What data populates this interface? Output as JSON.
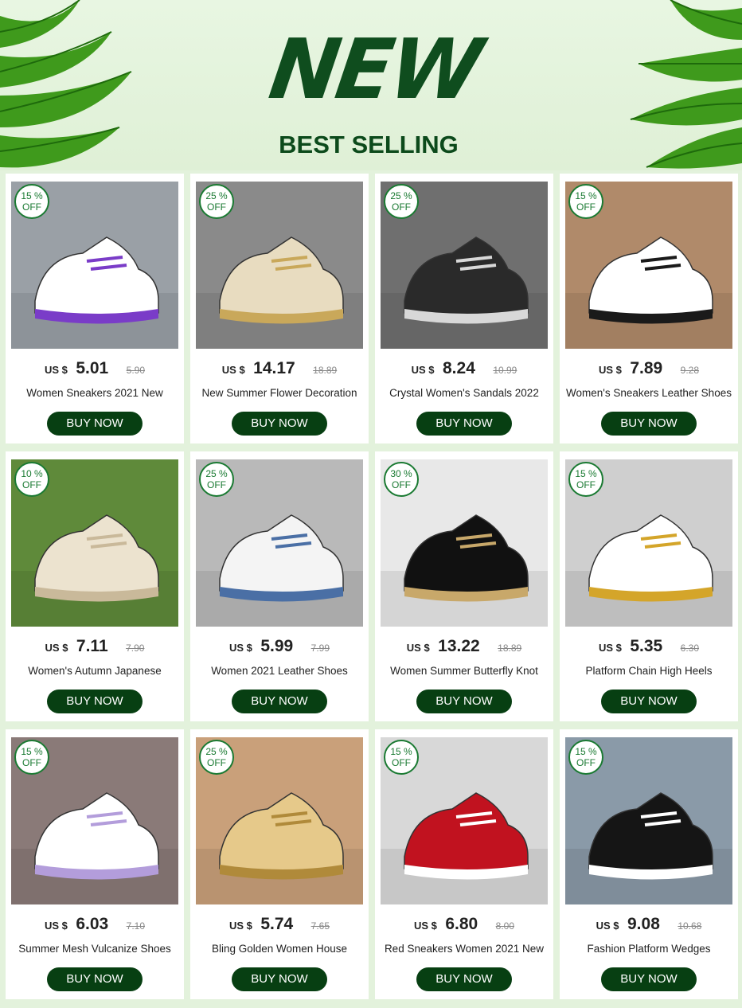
{
  "header": {
    "headline": "NEW",
    "subheading": "BEST SELLING"
  },
  "colors": {
    "background": "#e3f2dc",
    "headline": "#0f4d1e",
    "button": "#073f12",
    "badge": "#1a7a32"
  },
  "products": [
    {
      "badge_pct": "15 %",
      "badge_off": "OFF",
      "currency": "US $",
      "price": "5.01",
      "old_price": "5.90",
      "title": "Women Sneakers 2021 New",
      "button": "BUY NOW",
      "image": "white-purple-sneaker"
    },
    {
      "badge_pct": "25 %",
      "badge_off": "OFF",
      "currency": "US $",
      "price": "14.17",
      "old_price": "18.89",
      "title": "New Summer Flower Decoration",
      "button": "BUY NOW",
      "image": "flower-wedge-slipper"
    },
    {
      "badge_pct": "25 %",
      "badge_off": "OFF",
      "currency": "US $",
      "price": "8.24",
      "old_price": "10.99",
      "title": "Crystal Women's Sandals 2022",
      "button": "BUY NOW",
      "image": "crystal-sandal"
    },
    {
      "badge_pct": "15 %",
      "badge_off": "OFF",
      "currency": "US $",
      "price": "7.89",
      "old_price": "9.28",
      "title": "Women's Sneakers Leather Shoes",
      "button": "BUY NOW",
      "image": "white-leather-sneaker"
    },
    {
      "badge_pct": "10 %",
      "badge_off": "OFF",
      "currency": "US $",
      "price": "7.11",
      "old_price": "7.90",
      "title": "Women's  Autumn Japanese",
      "button": "BUY NOW",
      "image": "beige-platform-loafer"
    },
    {
      "badge_pct": "25 %",
      "badge_off": "OFF",
      "currency": "US $",
      "price": "5.99",
      "old_price": "7.99",
      "title": "Women 2021 Leather Shoes",
      "button": "BUY NOW",
      "image": "white-slip-on"
    },
    {
      "badge_pct": "30 %",
      "badge_off": "OFF",
      "currency": "US $",
      "price": "13.22",
      "old_price": "18.89",
      "title": "Women Summer Butterfly Knot",
      "button": "BUY NOW",
      "image": "espadrille-wedge"
    },
    {
      "badge_pct": "15 %",
      "badge_off": "OFF",
      "currency": "US $",
      "price": "5.35",
      "old_price": "6.30",
      "title": "Platform Chain High Heels",
      "button": "BUY NOW",
      "image": "chain-platform-slide"
    },
    {
      "badge_pct": "15 %",
      "badge_off": "OFF",
      "currency": "US $",
      "price": "6.03",
      "old_price": "7.10",
      "title": "Summer Mesh Vulcanize Shoes",
      "button": "BUY NOW",
      "image": "white-mesh-sneaker"
    },
    {
      "badge_pct": "25 %",
      "badge_off": "OFF",
      "currency": "US $",
      "price": "5.74",
      "old_price": "7.65",
      "title": "Bling Golden Women House",
      "button": "BUY NOW",
      "image": "gold-bling-wedge"
    },
    {
      "badge_pct": "15 %",
      "badge_off": "OFF",
      "currency": "US $",
      "price": "6.80",
      "old_price": "8.00",
      "title": "Red Sneakers Women 2021 New",
      "button": "BUY NOW",
      "image": "red-high-top"
    },
    {
      "badge_pct": "15 %",
      "badge_off": "OFF",
      "currency": "US $",
      "price": "9.08",
      "old_price": "10.68",
      "title": "Fashion Platform Wedges",
      "button": "BUY NOW",
      "image": "black-platform-wedge"
    }
  ]
}
